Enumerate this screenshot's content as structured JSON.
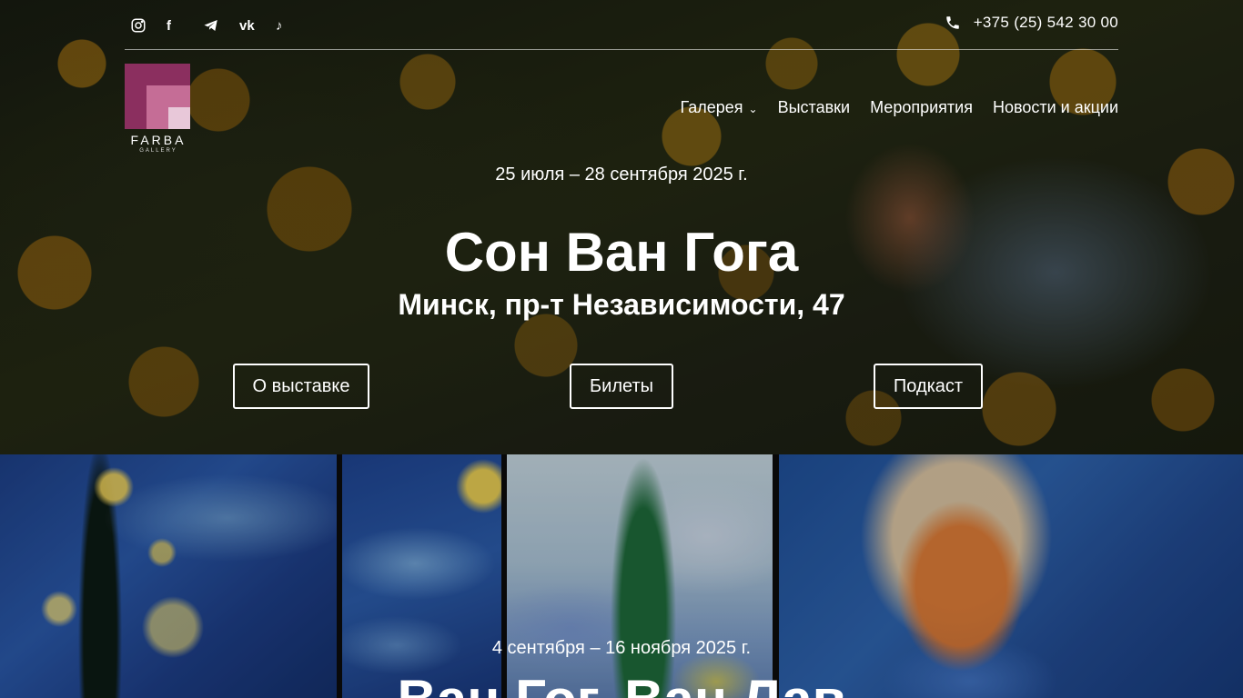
{
  "header": {
    "social": [
      {
        "name": "instagram-icon"
      },
      {
        "name": "facebook-icon",
        "glyph": "f"
      },
      {
        "name": "telegram-icon"
      },
      {
        "name": "vk-icon",
        "glyph": "vk"
      },
      {
        "name": "tiktok-icon",
        "glyph": "♪"
      }
    ],
    "phone": "+375 (25) 542 30 00",
    "logo": {
      "name": "FARBA",
      "sub": "GALLERY"
    },
    "nav": [
      {
        "label": "Галерея",
        "has_dropdown": true
      },
      {
        "label": "Выставки"
      },
      {
        "label": "Мероприятия"
      },
      {
        "label": "Новости и акции"
      }
    ]
  },
  "hero1": {
    "date": "25 июля – 28 сентября 2025 г.",
    "title": "Сон Ван Гога",
    "address": "Минск, пр-т Независимости, 47",
    "buttons": {
      "about": "О выставке",
      "tickets": "Билеты",
      "podcast": "Подкаст"
    }
  },
  "hero2": {
    "date": "4 сентября – 16 ноября 2025 г.",
    "title": "Ван Гог. Ван Лав"
  },
  "colors": {
    "logo_dark": "#8b2f5f",
    "logo_mid": "#c56d96",
    "logo_light": "#e8c8d9"
  }
}
